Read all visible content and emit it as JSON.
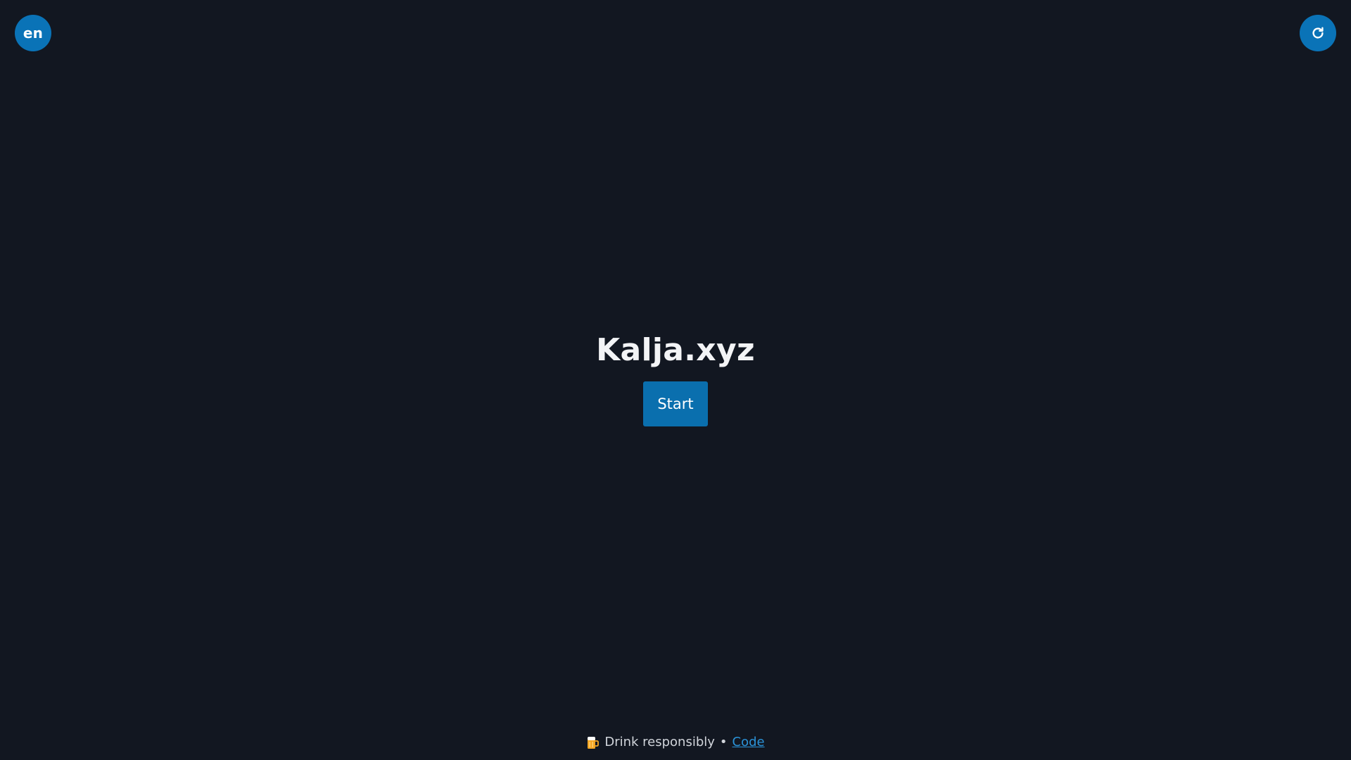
{
  "header": {
    "language_label": "en",
    "language_icon": "language-toggle",
    "refresh_icon": "refresh-icon"
  },
  "main": {
    "title": "Kalja.xyz",
    "start_label": "Start"
  },
  "footer": {
    "beer_icon": "beer-mug-icon",
    "text": "Drink responsibly",
    "separator": "•",
    "code_link": "Code"
  },
  "colors": {
    "background": "#121721",
    "accent": "#0a73b7",
    "link": "#2b93d8",
    "text": "#f3f4f6"
  }
}
